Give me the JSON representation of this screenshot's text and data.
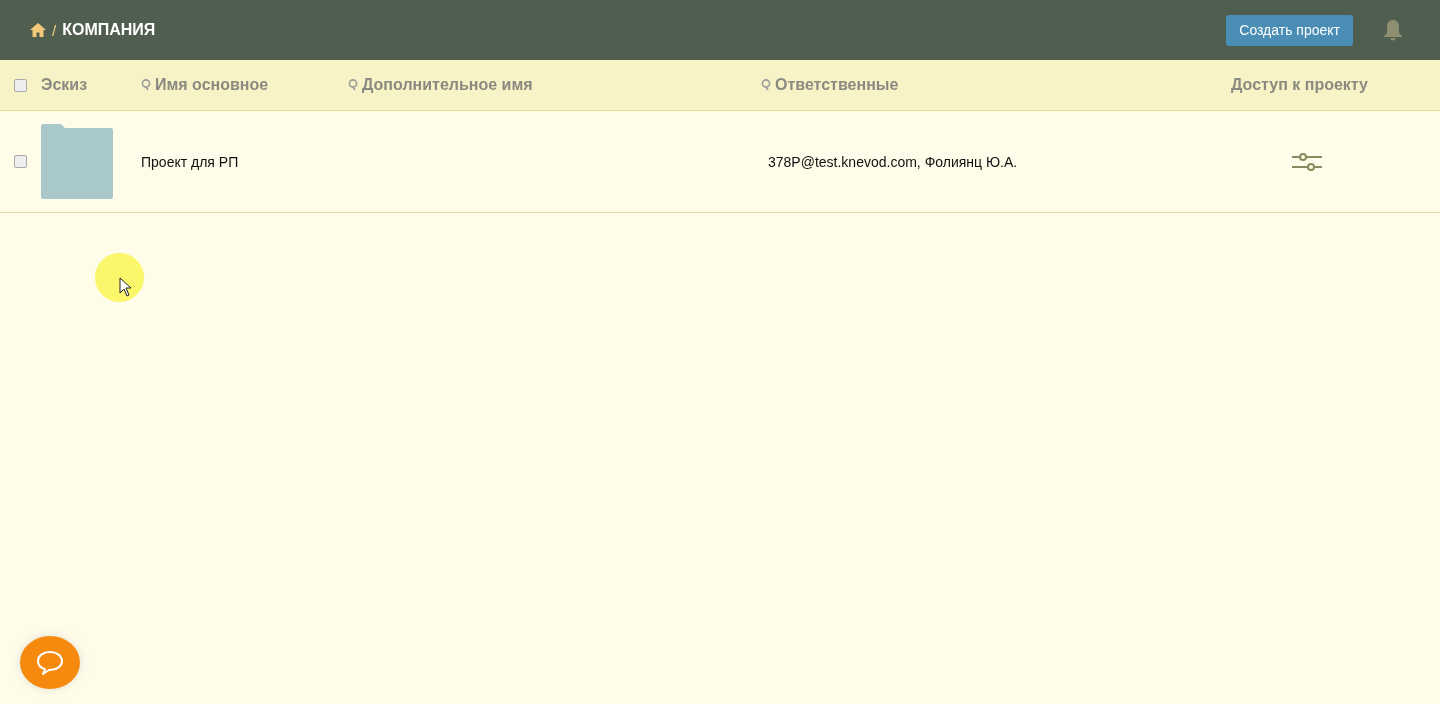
{
  "header": {
    "breadcrumb_separator": "/",
    "breadcrumb_current": "КОМПАНИЯ",
    "create_button": "Создать проект"
  },
  "table": {
    "select_all": {
      "checked": false
    },
    "columns": [
      {
        "label": "Эскиз",
        "searchable": false
      },
      {
        "label": "Имя основное",
        "searchable": true
      },
      {
        "label": "Дополнительное имя",
        "searchable": true
      },
      {
        "label": "Ответственные",
        "searchable": true
      },
      {
        "label": "Доступ к проекту",
        "searchable": false
      }
    ],
    "rows": [
      {
        "checked": false,
        "name": "Проект для РП",
        "alt_name": "",
        "responsible": "378P@test.knevod.com, Фолиянц Ю.А."
      }
    ]
  }
}
